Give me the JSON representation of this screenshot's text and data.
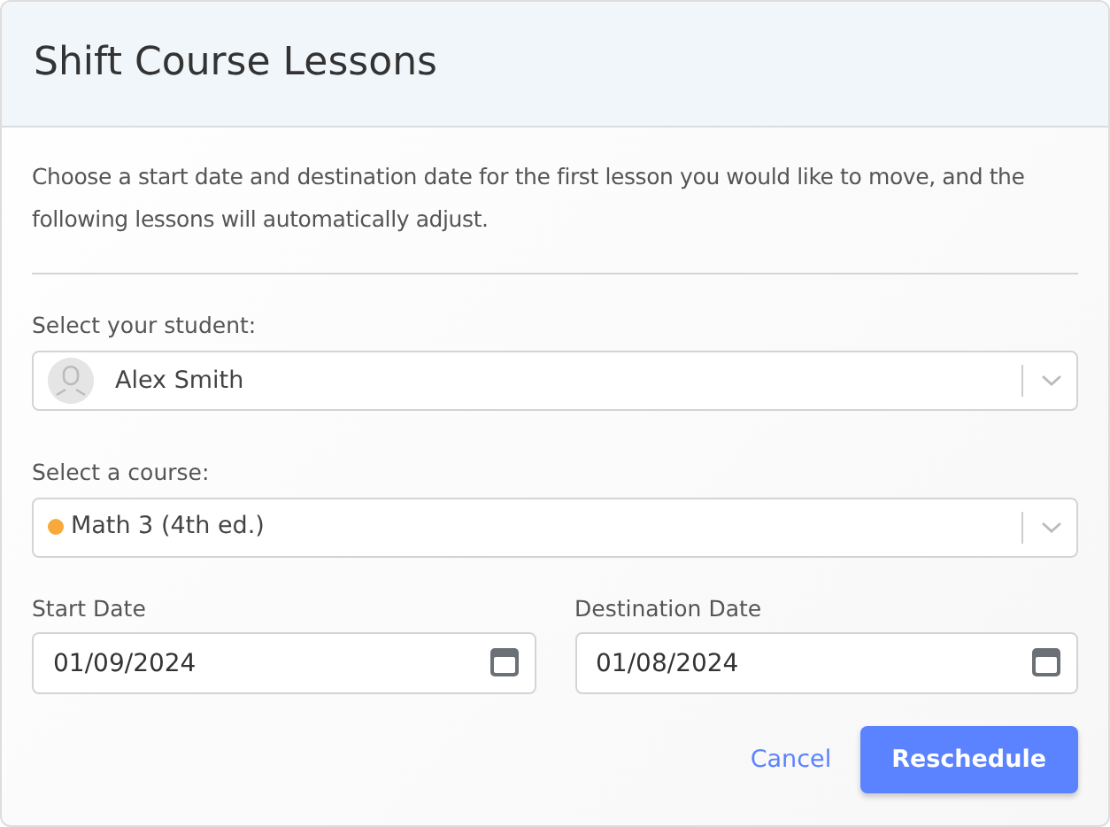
{
  "dialog": {
    "title": "Shift Course Lessons",
    "description": "Choose a start date and destination date for the first lesson you would like to move, and the following lessons will automatically adjust."
  },
  "student": {
    "label": "Select your student:",
    "value": "Alex Smith"
  },
  "course": {
    "label": "Select a course:",
    "value": "Math 3 (4th ed.)",
    "color": "#f8a93a"
  },
  "dates": [
    {
      "label": "Start Date",
      "value": "01/09/2024"
    },
    {
      "label": "Destination Date",
      "value": "01/08/2024"
    }
  ],
  "buttons": [
    {
      "label": "Cancel",
      "kind": "link"
    },
    {
      "label": "Reschedule",
      "kind": "primary"
    }
  ]
}
